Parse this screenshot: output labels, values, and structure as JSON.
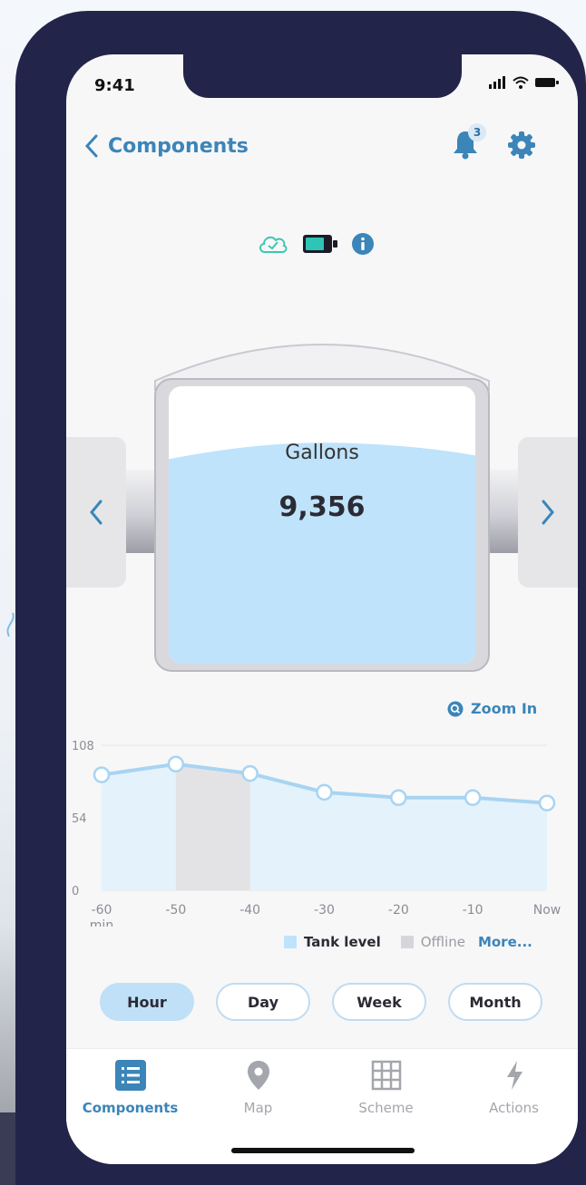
{
  "status_bar": {
    "time": "9:41"
  },
  "header": {
    "back_label": "Components",
    "notification_count": "3"
  },
  "tank": {
    "title": "Gallons",
    "value": "9,356",
    "fill_fraction": 0.77
  },
  "chart_controls": {
    "zoom_label": "Zoom In"
  },
  "chart_data": {
    "type": "area",
    "x": [
      "-60\nmin",
      "-50",
      "-40",
      "-30",
      "-20",
      "-10",
      "Now"
    ],
    "series": [
      {
        "name": "Tank level",
        "values": [
          86,
          94,
          87,
          73,
          69,
          69,
          65
        ]
      }
    ],
    "offline_ranges": [
      [
        "-50",
        "-40"
      ]
    ],
    "y_ticks": [
      "108",
      "54",
      "0"
    ],
    "ylim": [
      0,
      108
    ],
    "grid": true,
    "colors": {
      "line": "#a8d4f2",
      "fill": "#e4f2fc",
      "offline": "#e3e3e6",
      "point_fill": "#ffffff"
    }
  },
  "legend": {
    "tank_level": "Tank level",
    "offline": "Offline",
    "more": "More..."
  },
  "range_buttons": [
    {
      "label": "Hour",
      "active": true
    },
    {
      "label": "Day",
      "active": false
    },
    {
      "label": "Week",
      "active": false
    },
    {
      "label": "Month",
      "active": false
    }
  ],
  "tabs": [
    {
      "label": "Components",
      "icon": "list-icon",
      "active": true
    },
    {
      "label": "Map",
      "icon": "map-pin-icon",
      "active": false
    },
    {
      "label": "Scheme",
      "icon": "grid-icon",
      "active": false
    },
    {
      "label": "Actions",
      "icon": "bolt-icon",
      "active": false
    }
  ],
  "colors": {
    "accent": "#3b85b9",
    "cloud": "#3cc7b0",
    "battery": "#2ec4b6",
    "water": "#bfe3fb",
    "frame": "#22244a"
  }
}
